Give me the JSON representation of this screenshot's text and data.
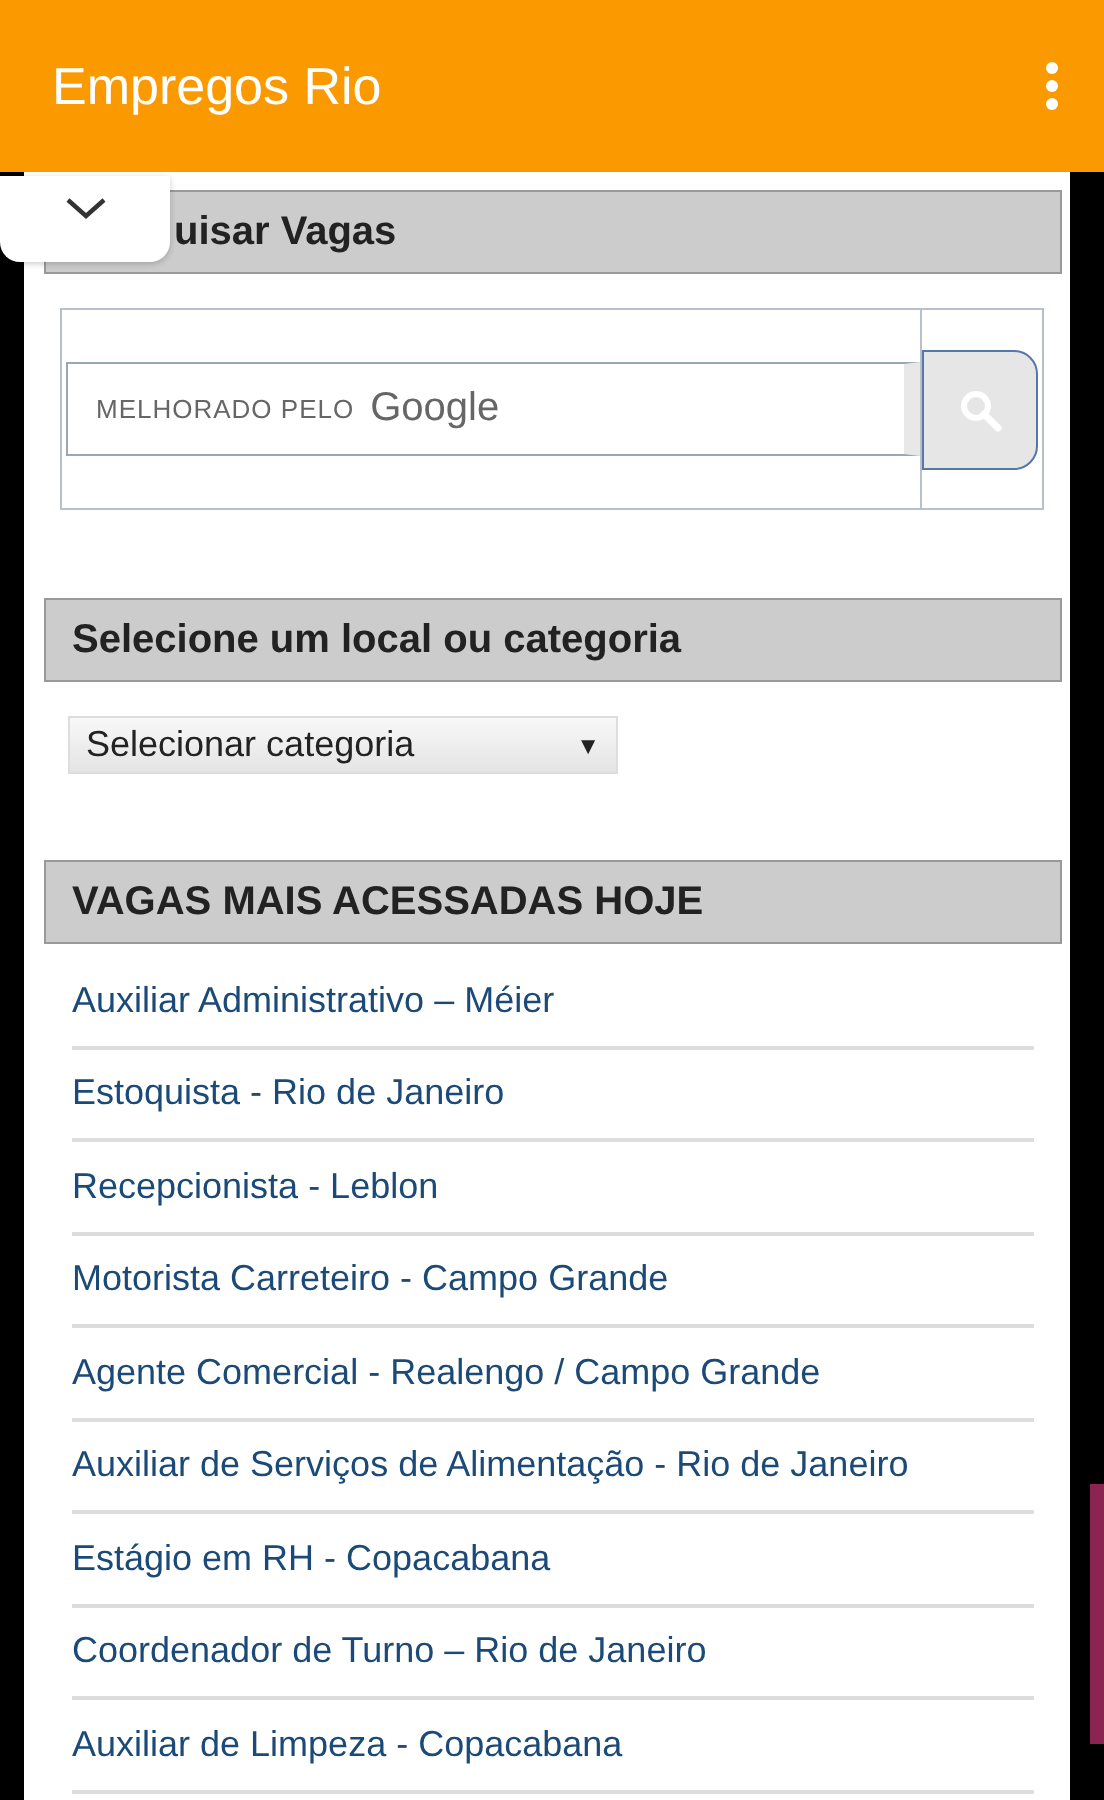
{
  "app_bar": {
    "title": "Empregos Rio"
  },
  "search_section": {
    "heading": "uisar Vagas",
    "placeholder_prefix": "MELHORADO PELO",
    "placeholder_brand": "Google"
  },
  "category_section": {
    "heading": "Selecione um local ou categoria",
    "select_value": "Selecionar categoria",
    "select_arrow": "▼"
  },
  "jobs_section": {
    "heading": "VAGAS MAIS ACESSADAS HOJE",
    "items": [
      {
        "label": "Auxiliar Administrativo – Méier"
      },
      {
        "label": "Estoquista - Rio de Janeiro"
      },
      {
        "label": "Recepcionista - Leblon"
      },
      {
        "label": "Motorista Carreteiro - Campo Grande"
      },
      {
        "label": "Agente Comercial - Realengo / Campo Grande"
      },
      {
        "label": "Auxiliar de Serviços de Alimentação - Rio de Janeiro"
      },
      {
        "label": "Estágio em RH - Copacabana"
      },
      {
        "label": "Coordenador de Turno – Rio de Janeiro"
      },
      {
        "label": "Auxiliar de Limpeza - Copacabana"
      }
    ]
  }
}
